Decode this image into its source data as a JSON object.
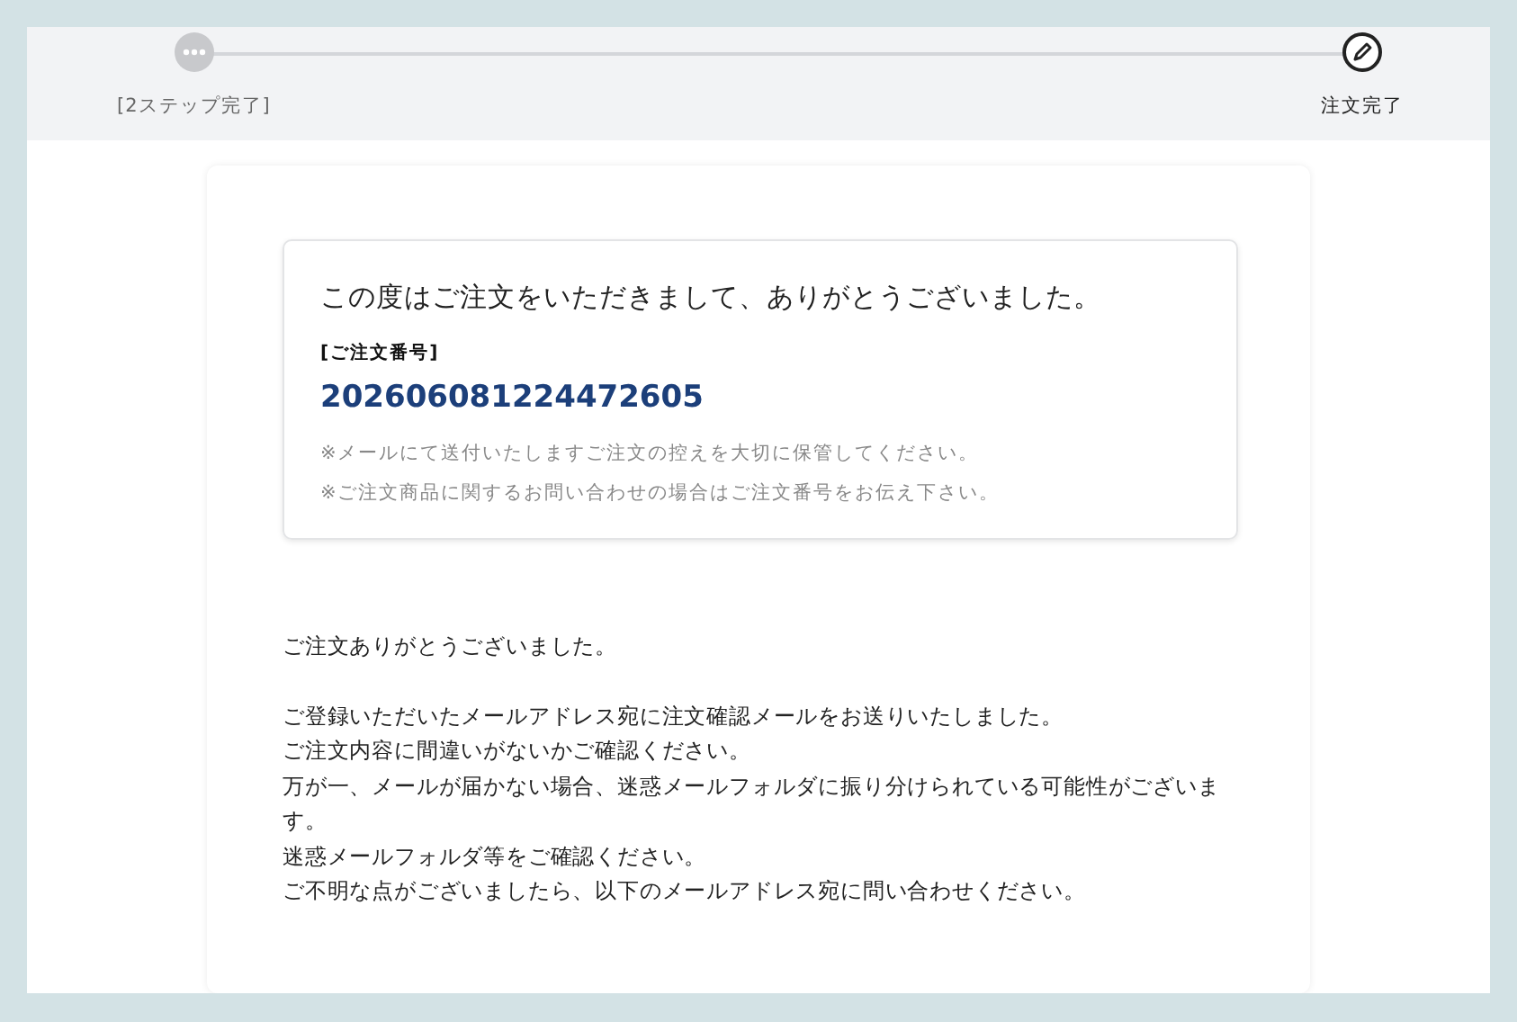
{
  "steps": [
    {
      "label": "[2ステップ完了]",
      "kind": "dots",
      "current": false
    },
    {
      "label": "注文完了",
      "kind": "pencil",
      "current": true
    }
  ],
  "thanks_box": {
    "heading": "この度はご注文をいただきまして、ありがとうございました。",
    "order_label": "[ご注文番号]",
    "order_number": "202606081224472605",
    "notes": [
      "※メールにて送付いたしますご注文の控えを大切に保管してください。",
      "※ご注文商品に関するお問い合わせの場合はご注文番号をお伝え下さい。"
    ]
  },
  "message": [
    [
      "ご注文ありがとうございました。"
    ],
    [
      "ご登録いただいたメールアドレス宛に注文確認メールをお送りいたしました。",
      "ご注文内容に間違いがないかご確認ください。",
      "万が一、メールが届かない場合、迷惑メールフォルダに振り分けられている可能性がございます。",
      "迷惑メールフォルダ等をご確認ください。",
      "ご不明な点がございましたら、以下のメールアドレス宛に問い合わせください。"
    ]
  ]
}
